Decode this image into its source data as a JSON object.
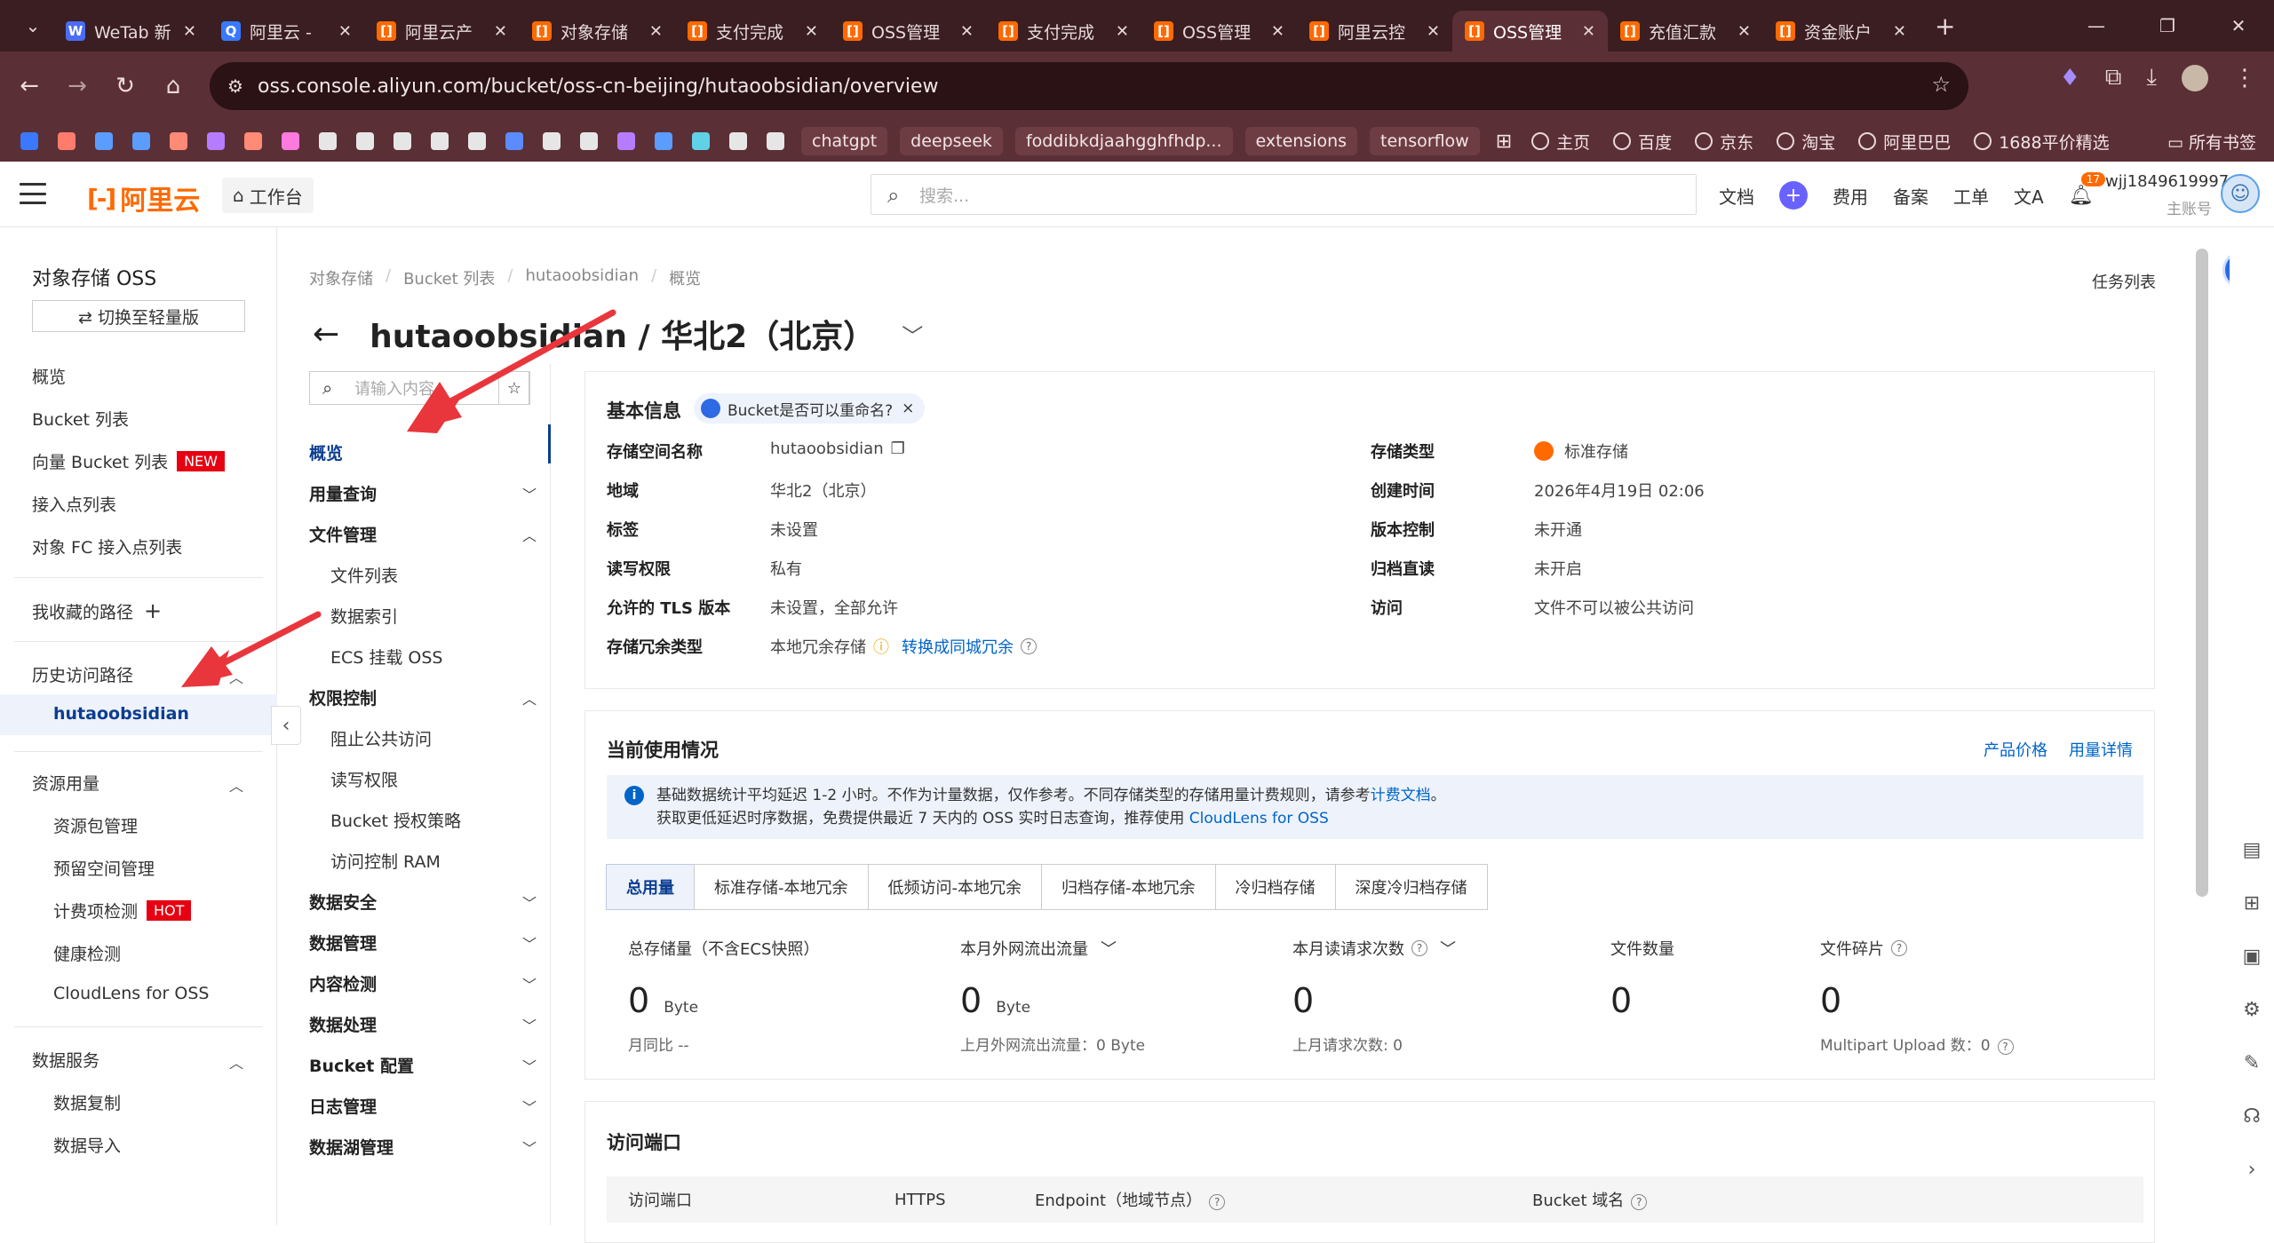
{
  "browser": {
    "tabs": [
      {
        "title": "WeTab 新",
        "fav_color": "#4a6cf7",
        "fav": "W"
      },
      {
        "title": "阿里云 - ",
        "fav_color": "#3a78ff",
        "fav": "Q"
      },
      {
        "title": "阿里云产",
        "fav_color": "#ff6a00",
        "fav": "[]"
      },
      {
        "title": "对象存储",
        "fav_color": "#ff6a00",
        "fav": "[]"
      },
      {
        "title": "支付完成",
        "fav_color": "#ff6a00",
        "fav": "[]"
      },
      {
        "title": "OSS管理",
        "fav_color": "#ff6a00",
        "fav": "[]"
      },
      {
        "title": "支付完成",
        "fav_color": "#ff6a00",
        "fav": "[]"
      },
      {
        "title": "OSS管理",
        "fav_color": "#ff6a00",
        "fav": "[]"
      },
      {
        "title": "阿里云控",
        "fav_color": "#ff6a00",
        "fav": "[]"
      },
      {
        "title": "OSS管理",
        "fav_color": "#ff6a00",
        "fav": "[]",
        "active": true
      },
      {
        "title": "充值汇款",
        "fav_color": "#ff6a00",
        "fav": "[]"
      },
      {
        "title": "资金账户",
        "fav_color": "#ff6a00",
        "fav": "[]"
      }
    ],
    "url": "oss.console.aliyun.com/bucket/oss-cn-beijing/hutaoobsidian/overview",
    "bookmark_squares": [
      "#3a78ff",
      "#ff7b6b",
      "#5b9cff",
      "#5b9cff",
      "#ff8a75",
      "#b57cff",
      "#ff8a75",
      "#ff7adf",
      "#e6e6e6",
      "#e6e6e6",
      "#e6e6e6",
      "#e6e6e6",
      "#e6e6e6",
      "#5b8cff",
      "#e6e6e6",
      "#e6e6e6",
      "#b57cff",
      "#5b9cff",
      "#5fd2e8",
      "#e6e6e6",
      "#e6e6e6"
    ],
    "bookmark_pills": [
      "chatgpt",
      "deepseek",
      "foddibkdjaahgghfhdp...",
      "extensions",
      "tensorflow"
    ],
    "bookmark_links": [
      "主页",
      "百度",
      "京东",
      "淘宝",
      "阿里巴巴",
      "1688平价精选"
    ],
    "all_bookmarks": "所有书签"
  },
  "topbar": {
    "logo": "阿里云",
    "workbench": "工作台",
    "search_placeholder": "搜索...",
    "links": [
      "文档",
      "费用",
      "备案",
      "工单"
    ],
    "bell_count": "17",
    "account_name": "wjj1849619997",
    "account_role": "主账号"
  },
  "sidebar": {
    "title": "对象存储 OSS",
    "switch_label": "⇄ 切换至轻量版",
    "items": [
      "概览",
      "Bucket 列表",
      "向量 Bucket 列表",
      "接入点列表",
      "对象 FC 接入点列表"
    ],
    "new_tag": "NEW",
    "favorites": "我收藏的路径",
    "history": "历史访问路径",
    "history_active": "hutaoobsidian",
    "resource_group": "资源用量",
    "resource_items": [
      "资源包管理",
      "预留空间管理",
      "计费项检测",
      "健康检测",
      "CloudLens for OSS"
    ],
    "hot_tag": "HOT",
    "data_service": "数据服务",
    "data_items": [
      "数据复制",
      "数据导入"
    ]
  },
  "breadcrumb": [
    "对象存储",
    "Bucket 列表",
    "hutaoobsidian",
    "概览"
  ],
  "task_list": "任务列表",
  "page_title": "hutaoobsidian / 华北2（北京）",
  "subnav": {
    "search_placeholder": "请输入内容",
    "items": [
      {
        "label": "概览",
        "active": true
      },
      {
        "label": "用量查询"
      },
      {
        "label": "文件管理",
        "open": true,
        "subs": [
          "文件列表",
          "数据索引",
          "ECS 挂载 OSS"
        ]
      },
      {
        "label": "权限控制",
        "open": true,
        "subs": [
          "阻止公共访问",
          "读写权限",
          "Bucket 授权策略",
          "访问控制 RAM"
        ]
      },
      {
        "label": "数据安全"
      },
      {
        "label": "数据管理"
      },
      {
        "label": "内容检测"
      },
      {
        "label": "数据处理"
      },
      {
        "label": "Bucket 配置"
      },
      {
        "label": "日志管理"
      },
      {
        "label": "数据湖管理"
      }
    ]
  },
  "basic_info": {
    "title": "基本信息",
    "badge": "Bucket是否可以重命名?",
    "left": [
      {
        "k": "存储空间名称",
        "v": "hutaoobsidian"
      },
      {
        "k": "地域",
        "v": "华北2（北京）"
      },
      {
        "k": "标签",
        "v": "未设置"
      },
      {
        "k": "读写权限",
        "v": "私有"
      },
      {
        "k": "允许的 TLS 版本",
        "v": "未设置，全部允许"
      },
      {
        "k": "存储冗余类型",
        "v": "本地冗余存储",
        "link": "转换成同城冗余"
      }
    ],
    "right": [
      {
        "k": "存储类型",
        "v": "标准存储"
      },
      {
        "k": "创建时间",
        "v": "2026年4月19日 02:06"
      },
      {
        "k": "版本控制",
        "v": "未开通"
      },
      {
        "k": "归档直读",
        "v": "未开启"
      },
      {
        "k": "访问",
        "v": "文件不可以被公共访问"
      }
    ]
  },
  "usage": {
    "title": "当前使用情况",
    "links": [
      "产品价格",
      "用量详情"
    ],
    "notice_line1": "基础数据统计平均延迟 1-2 小时。不作为计量数据，仅作参考。不同存储类型的存储用量计费规则，请参考",
    "notice_link1": "计费文档",
    "notice_end1": "。",
    "notice_line2": "获取更低延迟时序数据，免费提供最近 7 天内的 OSS 实时日志查询，推荐使用 ",
    "notice_link2": "CloudLens for OSS",
    "tabs": [
      "总用量",
      "标准存储-本地冗余",
      "低频访问-本地冗余",
      "归档存储-本地冗余",
      "冷归档存储",
      "深度冷归档存储"
    ],
    "metrics": [
      {
        "label": "总存储量（不含ECS快照）",
        "value": "0",
        "unit": "Byte",
        "sub": "月同比 --"
      },
      {
        "label": "本月外网流出流量",
        "value": "0",
        "unit": "Byte",
        "sub": "上月外网流出流量：0 Byte"
      },
      {
        "label": "本月读请求次数",
        "value": "0",
        "unit": "",
        "sub": "上月请求次数:   0"
      },
      {
        "label": "文件数量",
        "value": "0",
        "unit": "",
        "sub": ""
      },
      {
        "label": "文件碎片",
        "value": "0",
        "unit": "",
        "sub": "Multipart Upload 数：0"
      }
    ]
  },
  "access": {
    "title": "访问端口",
    "columns": [
      "访问端口",
      "HTTPS",
      "Endpoint（地域节点）",
      "Bucket 域名"
    ]
  }
}
